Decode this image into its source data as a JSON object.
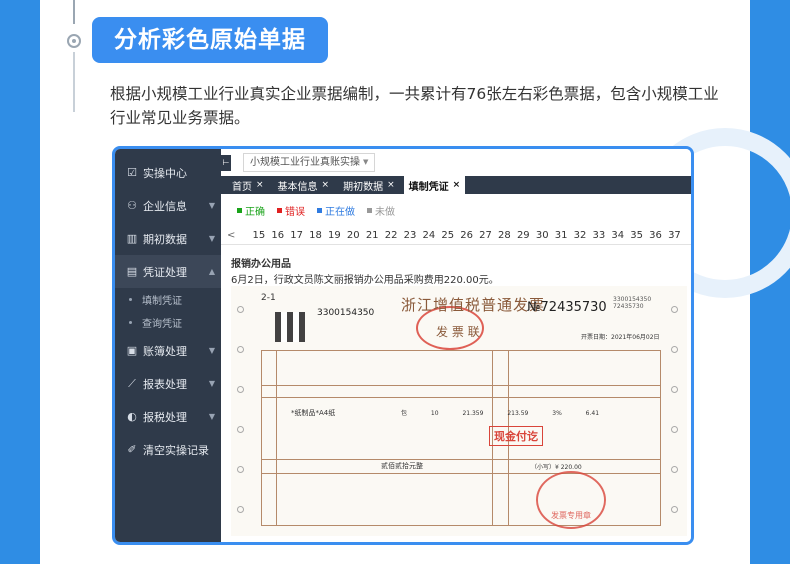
{
  "section": {
    "heading": "分析彩色原始单据",
    "intro": "根据小规模工业行业真实企业票据编制，一共累计有76张左右彩色票据，包含小规模工业行业常见业务票据。"
  },
  "sidebar": {
    "items": [
      {
        "label": "实操中心",
        "icon": "checklist-icon"
      },
      {
        "label": "企业信息",
        "icon": "users-icon"
      },
      {
        "label": "期初数据",
        "icon": "bar-chart-icon"
      },
      {
        "label": "凭证处理",
        "icon": "document-icon"
      },
      {
        "label": "账簿处理",
        "icon": "book-icon"
      },
      {
        "label": "报表处理",
        "icon": "line-chart-icon"
      },
      {
        "label": "报税处理",
        "icon": "tax-icon"
      },
      {
        "label": "清空实操记录",
        "icon": "broom-icon"
      }
    ],
    "subitems": [
      "填制凭证",
      "查询凭证"
    ]
  },
  "app": {
    "select_value": "小规模工业行业真账实操",
    "tabs": [
      "首页",
      "基本信息",
      "期初数据",
      "填制凭证"
    ],
    "tab_close": "×",
    "legend": [
      {
        "label": "正确",
        "color": "#1aa31a"
      },
      {
        "label": "错误",
        "color": "#e02020"
      },
      {
        "label": "正在做",
        "color": "#2f7be0"
      },
      {
        "label": "未做",
        "color": "#999999"
      }
    ],
    "prev_arrow": "<",
    "numbers": [
      "15",
      "16",
      "17",
      "18",
      "19",
      "20",
      "21",
      "22",
      "23",
      "24",
      "25",
      "26",
      "27",
      "28",
      "29",
      "30",
      "31",
      "32",
      "33",
      "34",
      "35",
      "36",
      "37"
    ],
    "case_title": "报销办公用品",
    "case_desc": "6月2日，行政文员陈文丽报销办公用品采购费用220.00元。"
  },
  "invoice": {
    "corner": "2-1",
    "code": "3300154350",
    "title": "浙江增值税普通发票",
    "subtitle": "发 票 联",
    "number": "№72435730",
    "number_small": "3300154350 72435730",
    "date": "开票日期：2021年06月02日",
    "item_name": "*纸制品*A4纸",
    "item_values": "包 10 21.359 213.59 3% 6.41",
    "total_caps": "贰佰贰拾元整",
    "total_amount": "（小写）¥ 220.00",
    "cash_stamp": "现金付讫",
    "seal_text": "发票专用章"
  }
}
